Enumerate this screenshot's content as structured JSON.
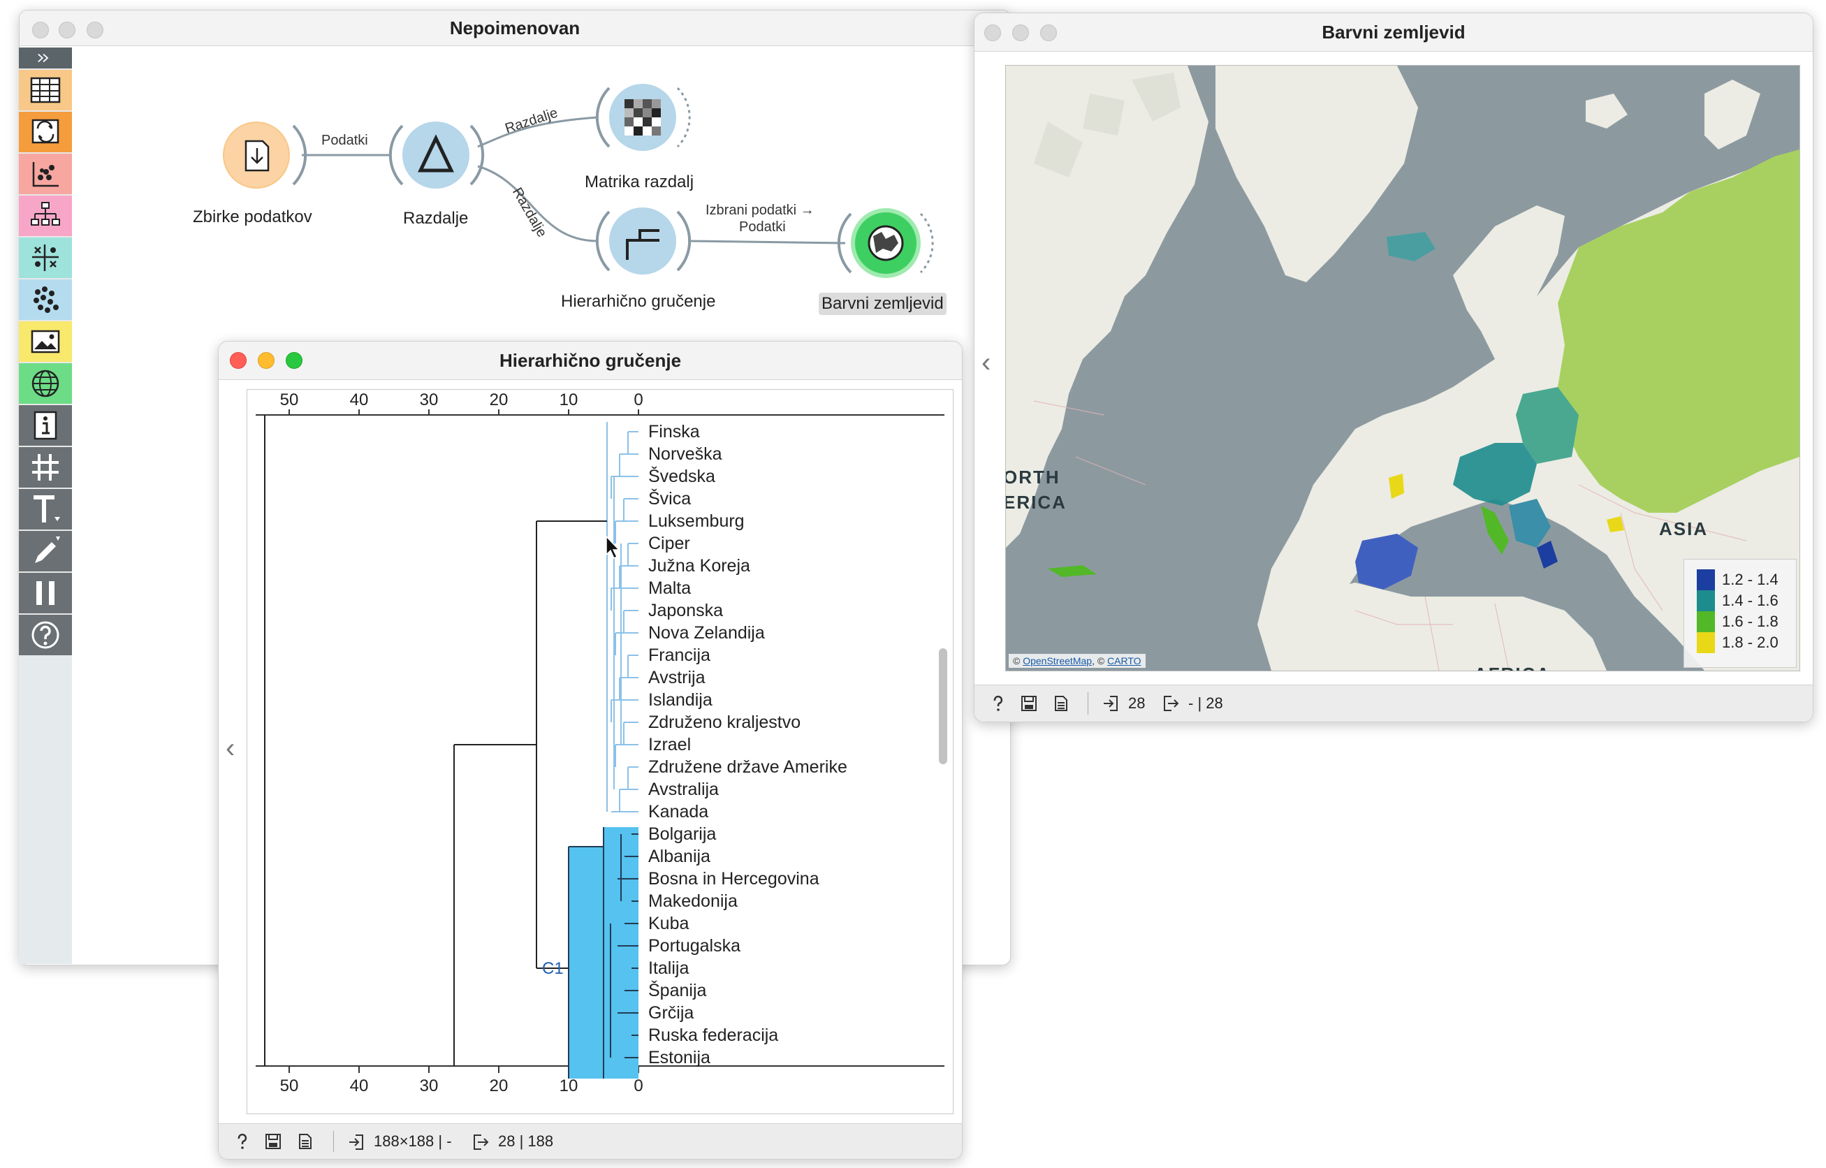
{
  "main_window": {
    "title": "Nepoimenovan"
  },
  "map_window": {
    "title": "Barvni zemljevid",
    "status_in": "28",
    "status_out": "- | 28"
  },
  "dendro_window": {
    "title": "Hierarhično gručenje",
    "status_in": "188×188 | -",
    "status_out": "28 | 188"
  },
  "toolbox": {
    "items": [
      "expand-icon",
      "data-table-icon",
      "transform-icon",
      "scatter-plot-icon",
      "tree-icon",
      "distributions-icon",
      "clusters-icon",
      "image-icon",
      "geo-icon",
      "info-icon",
      "grid-icon",
      "text-icon",
      "paint-icon",
      "pause-icon",
      "help-icon"
    ]
  },
  "workflow": {
    "nodes": [
      {
        "label": "Zbirke podatkov",
        "icon": "datasets-icon",
        "color": "#f8c888"
      },
      {
        "label": "Razdalje",
        "icon": "distances-icon",
        "color": "#b6d6ea"
      },
      {
        "label": "Matrika razdalj",
        "icon": "distance-matrix-icon",
        "color": "#b6d6ea"
      },
      {
        "label": "Hierarhično gručenje",
        "icon": "hierarchical-icon",
        "color": "#b6d6ea"
      },
      {
        "label": "Barvni zemljevid",
        "icon": "choropleth-icon",
        "color": "#5fdc7a"
      }
    ],
    "links": {
      "datasets_distances": "Podatki",
      "distances_matrix": "Razdalje",
      "distances_hier": "Razdalje",
      "hier_map_1": "Izbrani podatki →",
      "hier_map_2": "Podatki"
    }
  },
  "dendrogram": {
    "axis_ticks": [
      "50",
      "40",
      "30",
      "20",
      "10",
      "0"
    ],
    "cluster_label": "C1",
    "countries": [
      "Finska",
      "Norveška",
      "Švedska",
      "Švica",
      "Luksemburg",
      "Ciper",
      "Južna Koreja",
      "Malta",
      "Japonska",
      "Nova Zelandija",
      "Francija",
      "Avstrija",
      "Islandija",
      "Združeno kraljestvo",
      "Izrael",
      "Združene države Amerike",
      "Avstralija",
      "Kanada",
      "Bolgarija",
      "Albanija",
      "Bosna in Hercegovina",
      "Makedonija",
      "Kuba",
      "Portugalska",
      "Italija",
      "Španija",
      "Grčija",
      "Ruska federacija",
      "Estonija"
    ],
    "colors": {
      "unselected": "#8cc1e8",
      "selected": "#55c2ef",
      "frame": "#223b55"
    }
  },
  "map": {
    "labels": {
      "north_america_1": "ORTH",
      "north_america_2": "ERICA",
      "asia": "ASIA",
      "africa": "AFRICA"
    },
    "attribution": {
      "prefix": "© ",
      "osm": "OpenStreetMap",
      "sep": ", © ",
      "carto": "CARTO"
    },
    "legend": [
      {
        "label": "1.2 - 1.4",
        "color": "#1c3ea0"
      },
      {
        "label": "1.4 - 1.6",
        "color": "#1d8c8c"
      },
      {
        "label": "1.6 - 1.8",
        "color": "#52b828"
      },
      {
        "label": "1.8 - 2.0",
        "color": "#e8d818"
      }
    ],
    "colors": {
      "sea": "#8c9aa0",
      "land": "#ecece4",
      "russia": "#a8d060"
    }
  }
}
